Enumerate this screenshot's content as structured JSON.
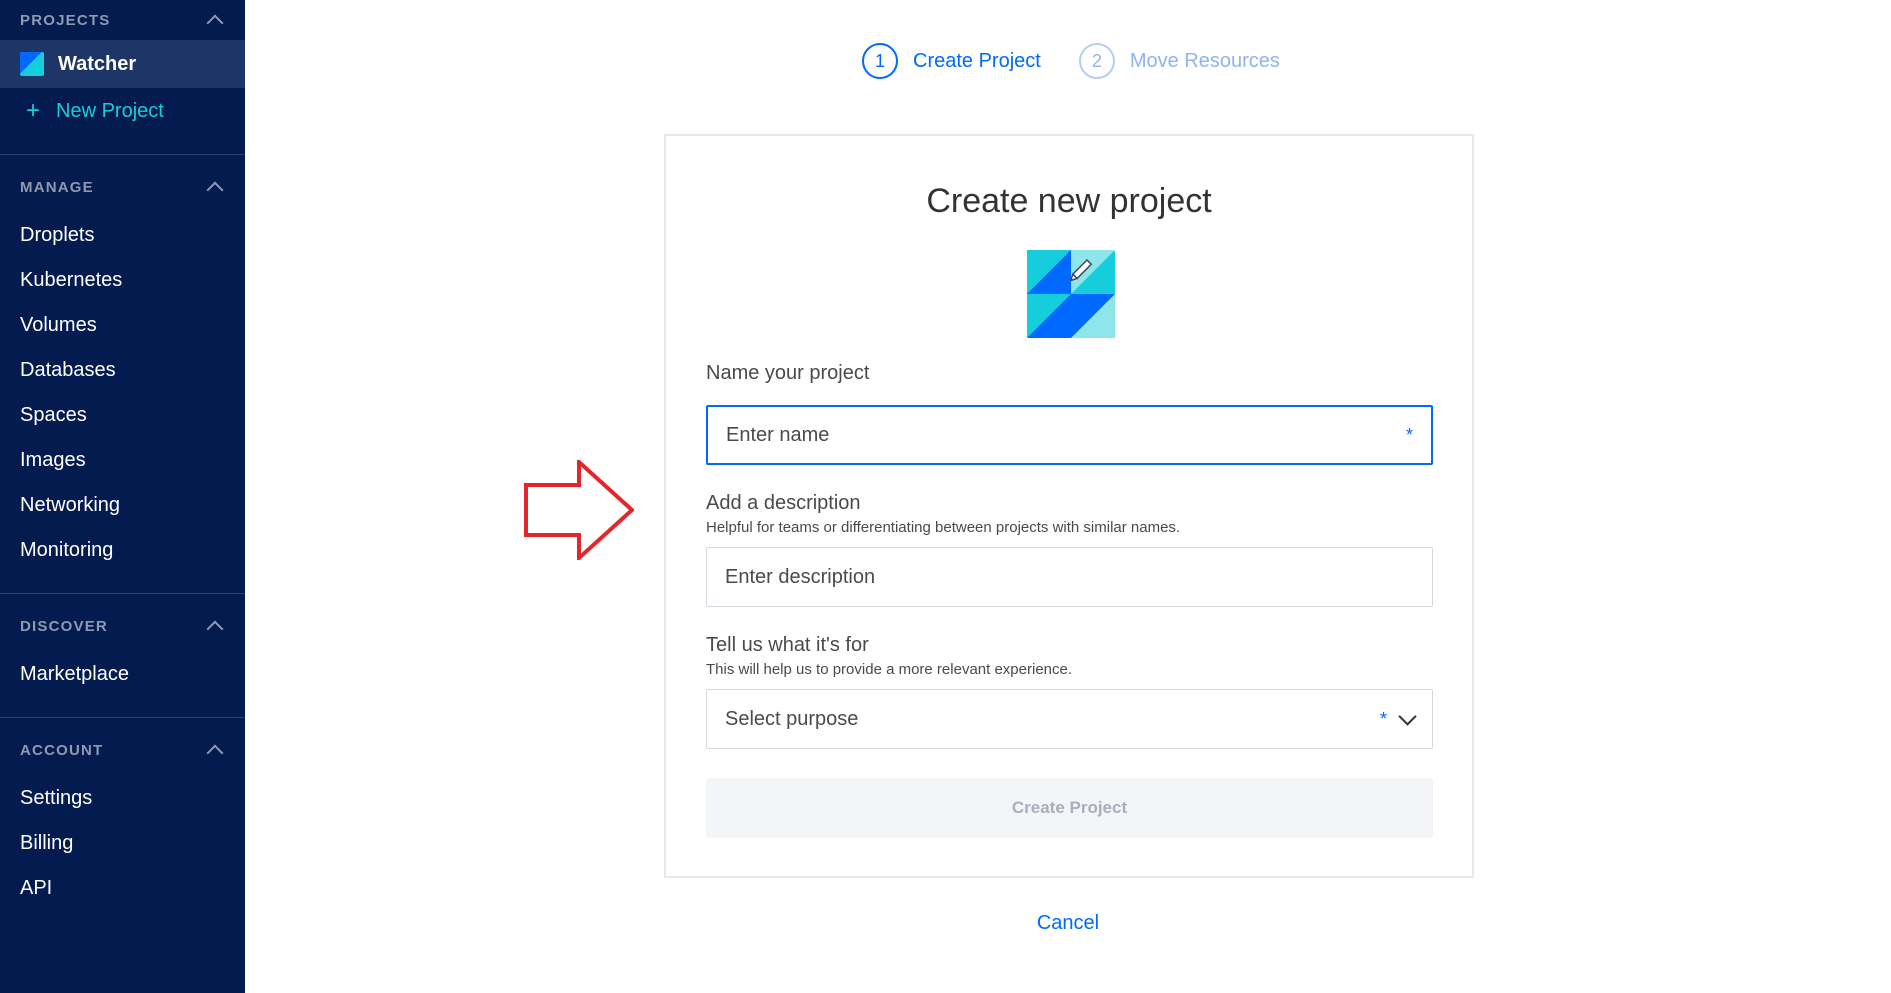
{
  "sidebar": {
    "projects_header": "PROJECTS",
    "active_project": "Watcher",
    "new_project_label": "New Project",
    "manage_header": "MANAGE",
    "manage_items": [
      "Droplets",
      "Kubernetes",
      "Volumes",
      "Databases",
      "Spaces",
      "Images",
      "Networking",
      "Monitoring"
    ],
    "discover_header": "DISCOVER",
    "discover_items": [
      "Marketplace"
    ],
    "account_header": "ACCOUNT",
    "account_items": [
      "Settings",
      "Billing",
      "API"
    ]
  },
  "stepper": {
    "steps": [
      {
        "number": "1",
        "label": "Create Project",
        "state": "active"
      },
      {
        "number": "2",
        "label": "Move Resources",
        "state": "inactive"
      }
    ]
  },
  "form": {
    "title": "Create new project",
    "name_label": "Name your project",
    "name_placeholder": "Enter name",
    "name_required_mark": "*",
    "description_label": "Add a description",
    "description_help": "Helpful for teams or differentiating between projects with similar names.",
    "description_placeholder": "Enter description",
    "purpose_label": "Tell us what it's for",
    "purpose_help": "This will help us to provide a more relevant experience.",
    "purpose_placeholder": "Select purpose",
    "purpose_required_mark": "*",
    "submit_label": "Create Project",
    "cancel_label": "Cancel"
  },
  "colors": {
    "sidebar_bg": "#031b4e",
    "accent_blue": "#0069ff",
    "accent_teal": "#15cddb",
    "annotation_arrow": "#e3262b"
  },
  "icons": {
    "project_logo": "project-logo-icon",
    "project_image": "project-image-icon",
    "annotation": "red-arrow-icon"
  }
}
